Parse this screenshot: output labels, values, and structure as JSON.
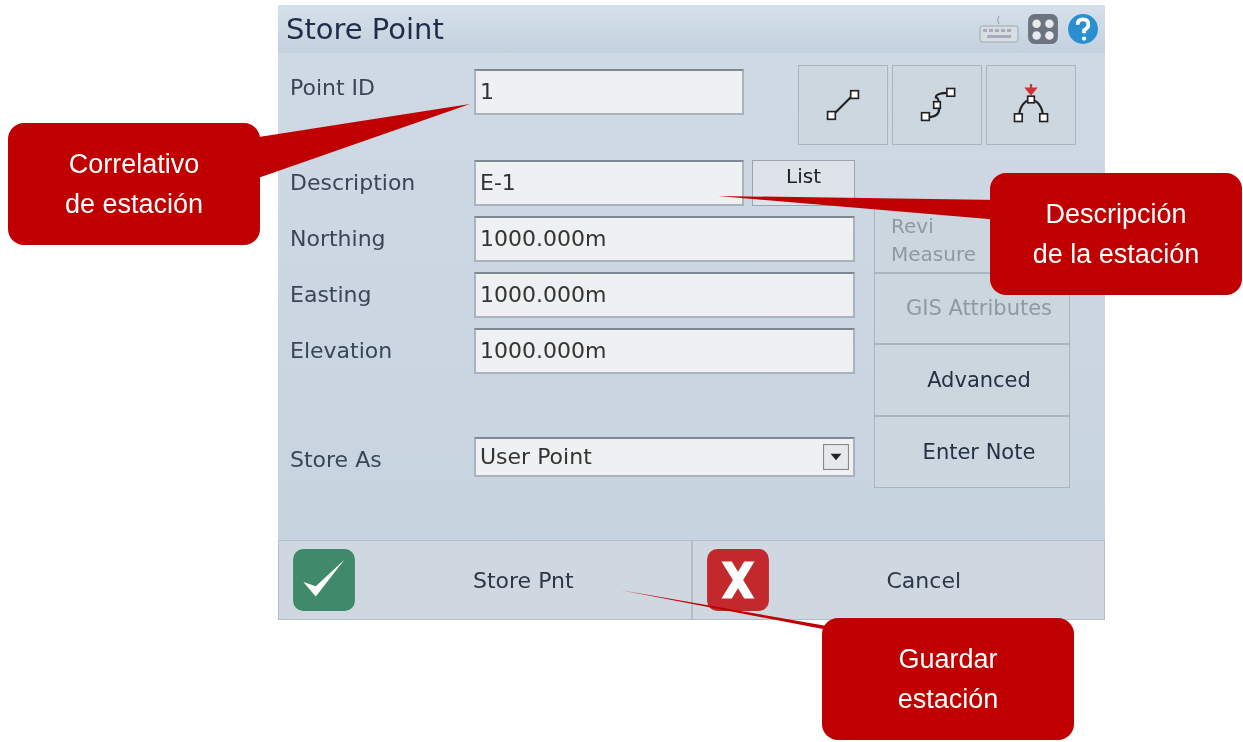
{
  "window": {
    "title": "Store Point"
  },
  "point_id": {
    "label": "Point ID",
    "value": "1"
  },
  "fields": [
    {
      "label": "Description",
      "value": "E-1",
      "kind": "list"
    },
    {
      "label": "Northing",
      "value": "1000.000m",
      "kind": "text"
    },
    {
      "label": "Easting",
      "value": "1000.000m",
      "kind": "text"
    },
    {
      "label": "Elevation",
      "value": "1000.000m",
      "kind": "text"
    }
  ],
  "list_button": "List",
  "store_as": {
    "label": "Store As",
    "value": "User Point"
  },
  "side_buttons": [
    {
      "lines": [
        "Revi",
        "Measure"
      ],
      "disabled": true
    },
    {
      "lines": [
        "GIS Attributes"
      ],
      "disabled": true
    },
    {
      "lines": [
        "Advanced"
      ],
      "disabled": false
    },
    {
      "lines": [
        "Enter Note"
      ],
      "disabled": false
    }
  ],
  "bottom_buttons": [
    {
      "label": "Store Pnt",
      "kind": "confirm"
    },
    {
      "label": "Cancel",
      "kind": "cancel"
    }
  ],
  "callouts": [
    {
      "lines": [
        "Correlativo",
        "de estación"
      ]
    },
    {
      "lines": [
        "Descripción",
        "de la estación"
      ]
    },
    {
      "lines": [
        "Guardar",
        "estación"
      ]
    }
  ]
}
